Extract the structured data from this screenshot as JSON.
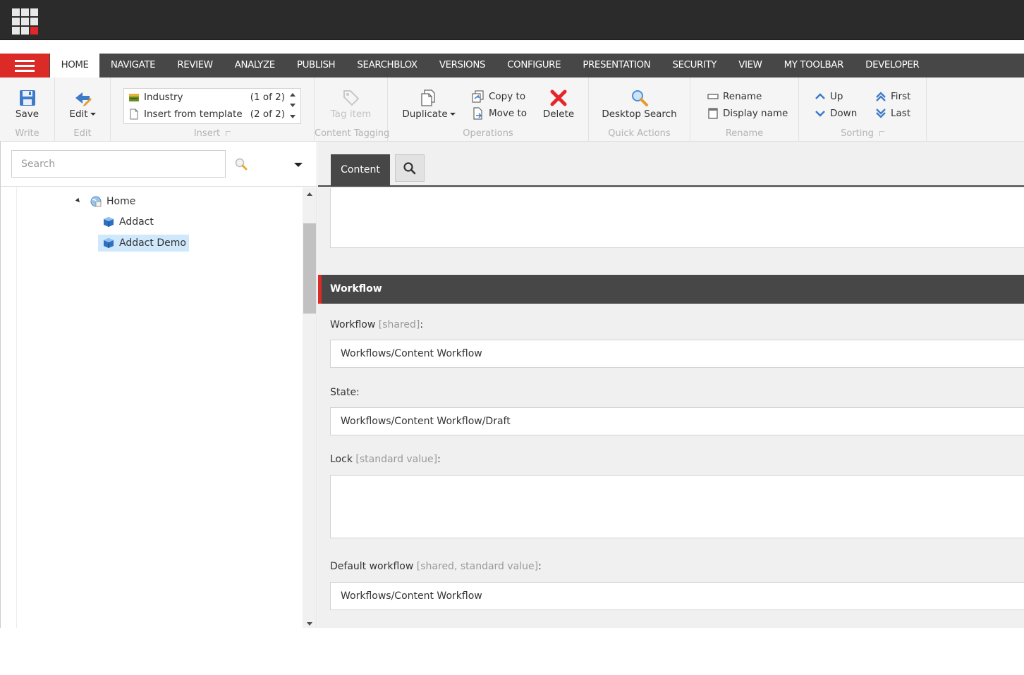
{
  "navigation": {
    "tabs": [
      {
        "label": "HOME",
        "active": true
      },
      {
        "label": "NAVIGATE"
      },
      {
        "label": "REVIEW"
      },
      {
        "label": "ANALYZE"
      },
      {
        "label": "PUBLISH"
      },
      {
        "label": "SEARCHBLOX"
      },
      {
        "label": "VERSIONS"
      },
      {
        "label": "CONFIGURE"
      },
      {
        "label": "PRESENTATION"
      },
      {
        "label": "SECURITY"
      },
      {
        "label": "VIEW"
      },
      {
        "label": "MY TOOLBAR"
      },
      {
        "label": "DEVELOPER"
      }
    ]
  },
  "ribbon": {
    "write": {
      "title": "Write",
      "save_label": "Save"
    },
    "edit": {
      "title": "Edit",
      "edit_label": "Edit"
    },
    "insert": {
      "title": "Insert",
      "options": [
        {
          "label": "Industry",
          "count": "(1 of 2)"
        },
        {
          "label": "Insert from template",
          "count": "(2 of 2)"
        }
      ]
    },
    "content_tagging": {
      "title": "Content Tagging",
      "tag_item_label": "Tag item"
    },
    "operations": {
      "title": "Operations",
      "duplicate_label": "Duplicate",
      "copy_to_label": "Copy to",
      "move_to_label": "Move to",
      "delete_label": "Delete"
    },
    "quick_actions": {
      "title": "Quick Actions",
      "desktop_search_label": "Desktop Search"
    },
    "rename": {
      "title": "Rename",
      "rename_label": "Rename",
      "display_name_label": "Display name"
    },
    "sorting": {
      "title": "Sorting",
      "up_label": "Up",
      "down_label": "Down",
      "first_label": "First",
      "last_label": "Last"
    }
  },
  "sidebar": {
    "search_placeholder": "Search",
    "tree": [
      {
        "label": "Home",
        "expanded": true
      },
      {
        "label": "Addact"
      },
      {
        "label": "Addact Demo",
        "selected": true
      }
    ]
  },
  "content": {
    "tabs": {
      "content_label": "Content"
    },
    "section": {
      "title": "Workflow"
    },
    "fields": {
      "workflow": {
        "label": "Workflow",
        "meta": "[shared]",
        "suffix": ":",
        "value": "Workflows/Content Workflow"
      },
      "state": {
        "label": "State:",
        "value": "Workflows/Content Workflow/Draft"
      },
      "lock": {
        "label": "Lock",
        "meta": "[standard value]",
        "suffix": ":",
        "value": ""
      },
      "default_workflow": {
        "label": "Default workflow",
        "meta": "[shared, standard value]",
        "suffix": ":",
        "value": "Workflows/Content Workflow"
      }
    }
  },
  "colors": {
    "topbar": "#2b2b2b",
    "navbar": "#474747",
    "accent_red": "#dc2a27",
    "selection": "#cfe8fb",
    "section_header": "#474747"
  }
}
